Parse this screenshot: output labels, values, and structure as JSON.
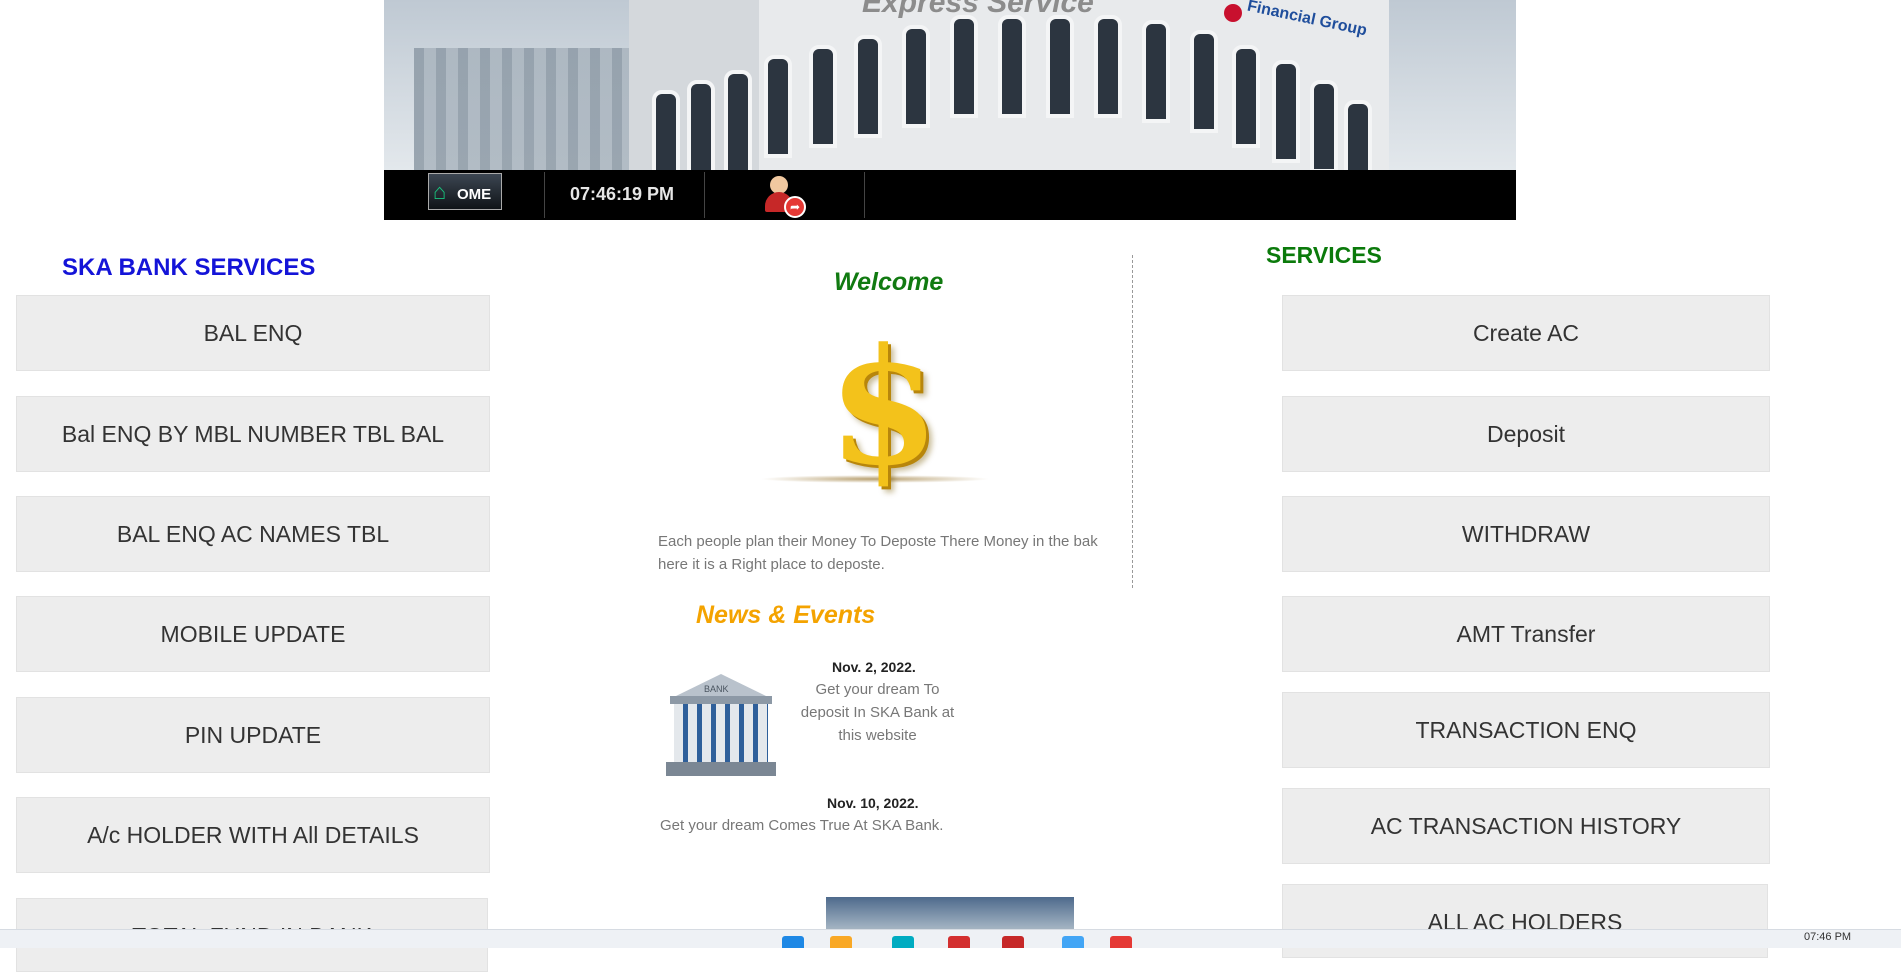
{
  "banner": {
    "overlay_title": "Express Service",
    "building_logo_text": "Financial Group"
  },
  "navbar": {
    "home_label": "OME",
    "clock": "07:46:19 PM"
  },
  "left": {
    "title": "SKA BANK SERVICES",
    "items": [
      {
        "label": "BAL ENQ"
      },
      {
        "label": "Bal ENQ BY MBL NUMBER TBL BAL"
      },
      {
        "label": "BAL ENQ AC NAMES TBL"
      },
      {
        "label": "MOBILE UPDATE"
      },
      {
        "label": "PIN UPDATE"
      },
      {
        "label": "A/c HOLDER WITH All DETAILS"
      },
      {
        "label": "TOTAL FUND IN BANK"
      }
    ]
  },
  "center": {
    "welcome_title": "Welcome",
    "welcome_text": "Each people plan their Money To Deposte There Money in the bak here it is a Right place to deposte.",
    "news_title": "News & Events",
    "bank_icon_label": "BANK",
    "news": [
      {
        "date": "Nov. 2, 2022.",
        "text": "Get your dream To deposit In SKA Bank at this website"
      },
      {
        "date": "Nov. 10, 2022.",
        "text": "Get your dream Comes True At SKA Bank."
      }
    ]
  },
  "right": {
    "title": "SERVICES",
    "items": [
      {
        "label": "Create AC"
      },
      {
        "label": "Deposit"
      },
      {
        "label": "WITHDRAW"
      },
      {
        "label": "AMT Transfer"
      },
      {
        "label": "TRANSACTION ENQ"
      },
      {
        "label": "AC TRANSACTION HISTORY"
      },
      {
        "label": "ALL AC HOLDERS"
      }
    ]
  },
  "taskbar": {
    "time": "07:46 PM",
    "icon_colors": [
      "#1e88e5",
      "#f9a825",
      "#00acc1",
      "#d32f2f",
      "#c62828",
      "#42a5f5",
      "#e53935"
    ]
  }
}
